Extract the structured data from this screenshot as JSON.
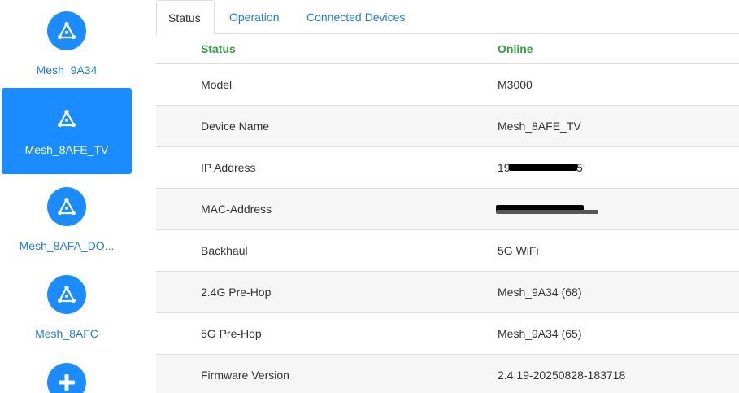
{
  "sidebar": {
    "nodes": [
      {
        "label": "Mesh_9A34",
        "icon": "mesh-node-icon"
      },
      {
        "label": "Mesh_8AFE_TV",
        "icon": "mesh-node-icon",
        "selected": true
      },
      {
        "label": "Mesh_8AFA_DO...",
        "icon": "mesh-node-icon"
      },
      {
        "label": "Mesh_8AFC",
        "icon": "mesh-node-icon"
      }
    ],
    "add_icon": "plus-icon"
  },
  "tabs": [
    {
      "label": "Status",
      "active": true
    },
    {
      "label": "Operation"
    },
    {
      "label": "Connected Devices"
    }
  ],
  "status_table": {
    "header": {
      "key": "Status",
      "value": "Online"
    },
    "rows": [
      {
        "key": "Model",
        "value": "M3000"
      },
      {
        "key": "Device Name",
        "value": "Mesh_8AFE_TV"
      },
      {
        "key": "IP Address",
        "value": "19",
        "value_suffix": "5",
        "redacted": true
      },
      {
        "key": "MAC-Address",
        "value": "",
        "redacted": true
      },
      {
        "key": "Backhaul",
        "value": "5G WiFi"
      },
      {
        "key": "2.4G Pre-Hop",
        "value": "Mesh_9A34 (68)"
      },
      {
        "key": "5G Pre-Hop",
        "value": "Mesh_9A34 (65)"
      },
      {
        "key": "Firmware Version",
        "value": "2.4.19-20250828-183718"
      }
    ]
  },
  "colors": {
    "accent": "#1a8cff",
    "link": "#1a7fd4",
    "status_green": "#2ea043",
    "row_alt": "#f6f6f6"
  }
}
